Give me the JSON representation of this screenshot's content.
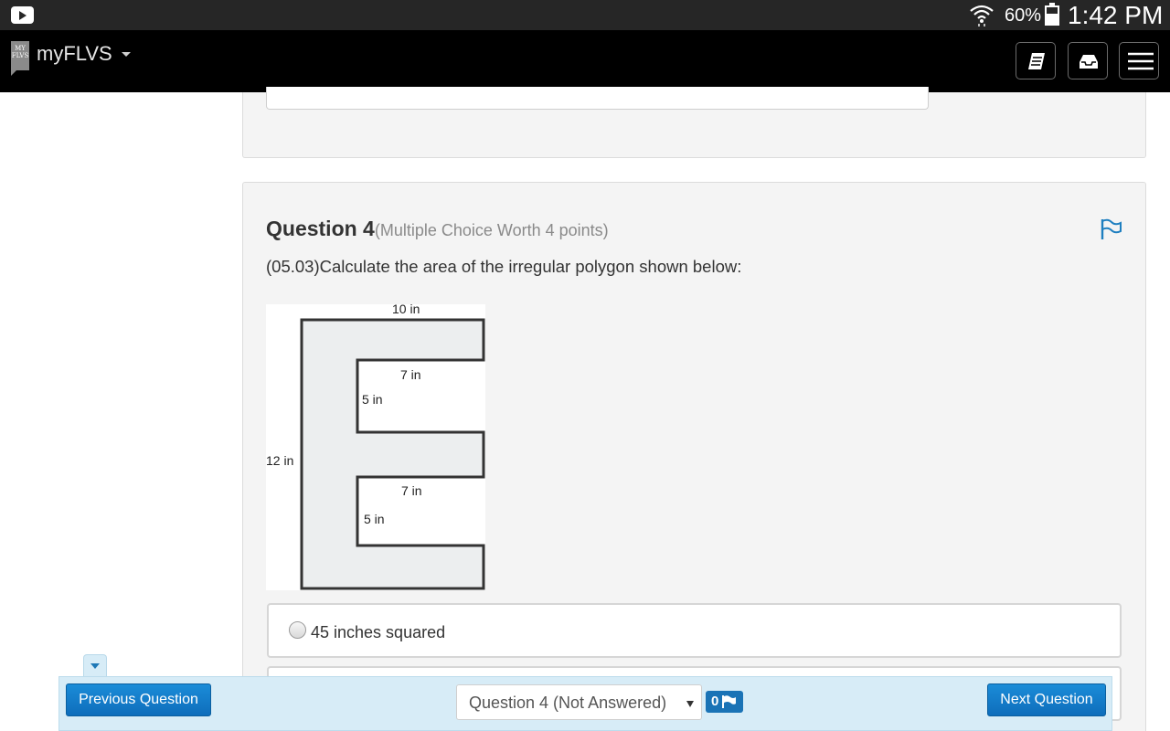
{
  "status_bar": {
    "battery": "60%",
    "time": "1:42 PM"
  },
  "app": {
    "badge": "MY FLVS",
    "name": "myFLVS"
  },
  "question": {
    "label": "Question 4",
    "meta": "(Multiple Choice Worth 4 points)",
    "text": "(05.03)Calculate the area of the irregular polygon shown below:",
    "figure_labels": {
      "top": "10 in",
      "upper_inner_width": "7 in",
      "upper_notch_height": "5 in",
      "left_height": "12 in",
      "lower_inner_width": "7 in",
      "lower_notch_height": "5 in"
    },
    "choices": [
      {
        "label": "45 inches squared"
      }
    ]
  },
  "footer": {
    "previous_label": "Previous Question",
    "selector_label": "Question 4 (Not Answered)",
    "flag_count": "0",
    "next_label": "Next Question"
  },
  "colors": {
    "header_bg": "#000000",
    "panel_bg": "#f4f4f4",
    "nav_bg": "#d7ecf7",
    "button_blue": "#1479c9",
    "flag_blue": "#1e7fc0"
  }
}
